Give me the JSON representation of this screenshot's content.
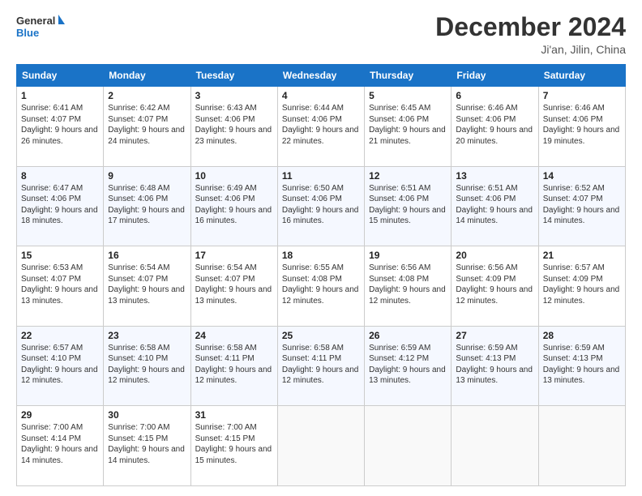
{
  "header": {
    "logo_line1": "General",
    "logo_line2": "Blue",
    "title": "December 2024",
    "location": "Ji'an, Jilin, China"
  },
  "weekdays": [
    "Sunday",
    "Monday",
    "Tuesday",
    "Wednesday",
    "Thursday",
    "Friday",
    "Saturday"
  ],
  "weeks": [
    [
      {
        "day": "1",
        "sunrise": "Sunrise: 6:41 AM",
        "sunset": "Sunset: 4:07 PM",
        "daylight": "Daylight: 9 hours and 26 minutes."
      },
      {
        "day": "2",
        "sunrise": "Sunrise: 6:42 AM",
        "sunset": "Sunset: 4:07 PM",
        "daylight": "Daylight: 9 hours and 24 minutes."
      },
      {
        "day": "3",
        "sunrise": "Sunrise: 6:43 AM",
        "sunset": "Sunset: 4:06 PM",
        "daylight": "Daylight: 9 hours and 23 minutes."
      },
      {
        "day": "4",
        "sunrise": "Sunrise: 6:44 AM",
        "sunset": "Sunset: 4:06 PM",
        "daylight": "Daylight: 9 hours and 22 minutes."
      },
      {
        "day": "5",
        "sunrise": "Sunrise: 6:45 AM",
        "sunset": "Sunset: 4:06 PM",
        "daylight": "Daylight: 9 hours and 21 minutes."
      },
      {
        "day": "6",
        "sunrise": "Sunrise: 6:46 AM",
        "sunset": "Sunset: 4:06 PM",
        "daylight": "Daylight: 9 hours and 20 minutes."
      },
      {
        "day": "7",
        "sunrise": "Sunrise: 6:46 AM",
        "sunset": "Sunset: 4:06 PM",
        "daylight": "Daylight: 9 hours and 19 minutes."
      }
    ],
    [
      {
        "day": "8",
        "sunrise": "Sunrise: 6:47 AM",
        "sunset": "Sunset: 4:06 PM",
        "daylight": "Daylight: 9 hours and 18 minutes."
      },
      {
        "day": "9",
        "sunrise": "Sunrise: 6:48 AM",
        "sunset": "Sunset: 4:06 PM",
        "daylight": "Daylight: 9 hours and 17 minutes."
      },
      {
        "day": "10",
        "sunrise": "Sunrise: 6:49 AM",
        "sunset": "Sunset: 4:06 PM",
        "daylight": "Daylight: 9 hours and 16 minutes."
      },
      {
        "day": "11",
        "sunrise": "Sunrise: 6:50 AM",
        "sunset": "Sunset: 4:06 PM",
        "daylight": "Daylight: 9 hours and 16 minutes."
      },
      {
        "day": "12",
        "sunrise": "Sunrise: 6:51 AM",
        "sunset": "Sunset: 4:06 PM",
        "daylight": "Daylight: 9 hours and 15 minutes."
      },
      {
        "day": "13",
        "sunrise": "Sunrise: 6:51 AM",
        "sunset": "Sunset: 4:06 PM",
        "daylight": "Daylight: 9 hours and 14 minutes."
      },
      {
        "day": "14",
        "sunrise": "Sunrise: 6:52 AM",
        "sunset": "Sunset: 4:07 PM",
        "daylight": "Daylight: 9 hours and 14 minutes."
      }
    ],
    [
      {
        "day": "15",
        "sunrise": "Sunrise: 6:53 AM",
        "sunset": "Sunset: 4:07 PM",
        "daylight": "Daylight: 9 hours and 13 minutes."
      },
      {
        "day": "16",
        "sunrise": "Sunrise: 6:54 AM",
        "sunset": "Sunset: 4:07 PM",
        "daylight": "Daylight: 9 hours and 13 minutes."
      },
      {
        "day": "17",
        "sunrise": "Sunrise: 6:54 AM",
        "sunset": "Sunset: 4:07 PM",
        "daylight": "Daylight: 9 hours and 13 minutes."
      },
      {
        "day": "18",
        "sunrise": "Sunrise: 6:55 AM",
        "sunset": "Sunset: 4:08 PM",
        "daylight": "Daylight: 9 hours and 12 minutes."
      },
      {
        "day": "19",
        "sunrise": "Sunrise: 6:56 AM",
        "sunset": "Sunset: 4:08 PM",
        "daylight": "Daylight: 9 hours and 12 minutes."
      },
      {
        "day": "20",
        "sunrise": "Sunrise: 6:56 AM",
        "sunset": "Sunset: 4:09 PM",
        "daylight": "Daylight: 9 hours and 12 minutes."
      },
      {
        "day": "21",
        "sunrise": "Sunrise: 6:57 AM",
        "sunset": "Sunset: 4:09 PM",
        "daylight": "Daylight: 9 hours and 12 minutes."
      }
    ],
    [
      {
        "day": "22",
        "sunrise": "Sunrise: 6:57 AM",
        "sunset": "Sunset: 4:10 PM",
        "daylight": "Daylight: 9 hours and 12 minutes."
      },
      {
        "day": "23",
        "sunrise": "Sunrise: 6:58 AM",
        "sunset": "Sunset: 4:10 PM",
        "daylight": "Daylight: 9 hours and 12 minutes."
      },
      {
        "day": "24",
        "sunrise": "Sunrise: 6:58 AM",
        "sunset": "Sunset: 4:11 PM",
        "daylight": "Daylight: 9 hours and 12 minutes."
      },
      {
        "day": "25",
        "sunrise": "Sunrise: 6:58 AM",
        "sunset": "Sunset: 4:11 PM",
        "daylight": "Daylight: 9 hours and 12 minutes."
      },
      {
        "day": "26",
        "sunrise": "Sunrise: 6:59 AM",
        "sunset": "Sunset: 4:12 PM",
        "daylight": "Daylight: 9 hours and 13 minutes."
      },
      {
        "day": "27",
        "sunrise": "Sunrise: 6:59 AM",
        "sunset": "Sunset: 4:13 PM",
        "daylight": "Daylight: 9 hours and 13 minutes."
      },
      {
        "day": "28",
        "sunrise": "Sunrise: 6:59 AM",
        "sunset": "Sunset: 4:13 PM",
        "daylight": "Daylight: 9 hours and 13 minutes."
      }
    ],
    [
      {
        "day": "29",
        "sunrise": "Sunrise: 7:00 AM",
        "sunset": "Sunset: 4:14 PM",
        "daylight": "Daylight: 9 hours and 14 minutes."
      },
      {
        "day": "30",
        "sunrise": "Sunrise: 7:00 AM",
        "sunset": "Sunset: 4:15 PM",
        "daylight": "Daylight: 9 hours and 14 minutes."
      },
      {
        "day": "31",
        "sunrise": "Sunrise: 7:00 AM",
        "sunset": "Sunset: 4:15 PM",
        "daylight": "Daylight: 9 hours and 15 minutes."
      },
      null,
      null,
      null,
      null
    ]
  ]
}
